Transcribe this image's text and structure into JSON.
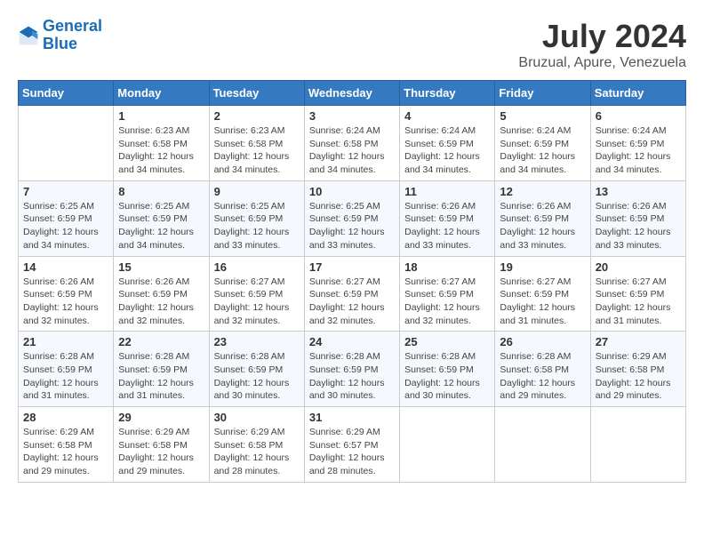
{
  "header": {
    "logo_line1": "General",
    "logo_line2": "Blue",
    "month_year": "July 2024",
    "location": "Bruzual, Apure, Venezuela"
  },
  "days_of_week": [
    "Sunday",
    "Monday",
    "Tuesday",
    "Wednesday",
    "Thursday",
    "Friday",
    "Saturday"
  ],
  "weeks": [
    [
      {
        "day": "",
        "info": ""
      },
      {
        "day": "1",
        "info": "Sunrise: 6:23 AM\nSunset: 6:58 PM\nDaylight: 12 hours\nand 34 minutes."
      },
      {
        "day": "2",
        "info": "Sunrise: 6:23 AM\nSunset: 6:58 PM\nDaylight: 12 hours\nand 34 minutes."
      },
      {
        "day": "3",
        "info": "Sunrise: 6:24 AM\nSunset: 6:58 PM\nDaylight: 12 hours\nand 34 minutes."
      },
      {
        "day": "4",
        "info": "Sunrise: 6:24 AM\nSunset: 6:59 PM\nDaylight: 12 hours\nand 34 minutes."
      },
      {
        "day": "5",
        "info": "Sunrise: 6:24 AM\nSunset: 6:59 PM\nDaylight: 12 hours\nand 34 minutes."
      },
      {
        "day": "6",
        "info": "Sunrise: 6:24 AM\nSunset: 6:59 PM\nDaylight: 12 hours\nand 34 minutes."
      }
    ],
    [
      {
        "day": "7",
        "info": "Sunrise: 6:25 AM\nSunset: 6:59 PM\nDaylight: 12 hours\nand 34 minutes."
      },
      {
        "day": "8",
        "info": "Sunrise: 6:25 AM\nSunset: 6:59 PM\nDaylight: 12 hours\nand 34 minutes."
      },
      {
        "day": "9",
        "info": "Sunrise: 6:25 AM\nSunset: 6:59 PM\nDaylight: 12 hours\nand 33 minutes."
      },
      {
        "day": "10",
        "info": "Sunrise: 6:25 AM\nSunset: 6:59 PM\nDaylight: 12 hours\nand 33 minutes."
      },
      {
        "day": "11",
        "info": "Sunrise: 6:26 AM\nSunset: 6:59 PM\nDaylight: 12 hours\nand 33 minutes."
      },
      {
        "day": "12",
        "info": "Sunrise: 6:26 AM\nSunset: 6:59 PM\nDaylight: 12 hours\nand 33 minutes."
      },
      {
        "day": "13",
        "info": "Sunrise: 6:26 AM\nSunset: 6:59 PM\nDaylight: 12 hours\nand 33 minutes."
      }
    ],
    [
      {
        "day": "14",
        "info": "Sunrise: 6:26 AM\nSunset: 6:59 PM\nDaylight: 12 hours\nand 32 minutes."
      },
      {
        "day": "15",
        "info": "Sunrise: 6:26 AM\nSunset: 6:59 PM\nDaylight: 12 hours\nand 32 minutes."
      },
      {
        "day": "16",
        "info": "Sunrise: 6:27 AM\nSunset: 6:59 PM\nDaylight: 12 hours\nand 32 minutes."
      },
      {
        "day": "17",
        "info": "Sunrise: 6:27 AM\nSunset: 6:59 PM\nDaylight: 12 hours\nand 32 minutes."
      },
      {
        "day": "18",
        "info": "Sunrise: 6:27 AM\nSunset: 6:59 PM\nDaylight: 12 hours\nand 32 minutes."
      },
      {
        "day": "19",
        "info": "Sunrise: 6:27 AM\nSunset: 6:59 PM\nDaylight: 12 hours\nand 31 minutes."
      },
      {
        "day": "20",
        "info": "Sunrise: 6:27 AM\nSunset: 6:59 PM\nDaylight: 12 hours\nand 31 minutes."
      }
    ],
    [
      {
        "day": "21",
        "info": "Sunrise: 6:28 AM\nSunset: 6:59 PM\nDaylight: 12 hours\nand 31 minutes."
      },
      {
        "day": "22",
        "info": "Sunrise: 6:28 AM\nSunset: 6:59 PM\nDaylight: 12 hours\nand 31 minutes."
      },
      {
        "day": "23",
        "info": "Sunrise: 6:28 AM\nSunset: 6:59 PM\nDaylight: 12 hours\nand 30 minutes."
      },
      {
        "day": "24",
        "info": "Sunrise: 6:28 AM\nSunset: 6:59 PM\nDaylight: 12 hours\nand 30 minutes."
      },
      {
        "day": "25",
        "info": "Sunrise: 6:28 AM\nSunset: 6:59 PM\nDaylight: 12 hours\nand 30 minutes."
      },
      {
        "day": "26",
        "info": "Sunrise: 6:28 AM\nSunset: 6:58 PM\nDaylight: 12 hours\nand 29 minutes."
      },
      {
        "day": "27",
        "info": "Sunrise: 6:29 AM\nSunset: 6:58 PM\nDaylight: 12 hours\nand 29 minutes."
      }
    ],
    [
      {
        "day": "28",
        "info": "Sunrise: 6:29 AM\nSunset: 6:58 PM\nDaylight: 12 hours\nand 29 minutes."
      },
      {
        "day": "29",
        "info": "Sunrise: 6:29 AM\nSunset: 6:58 PM\nDaylight: 12 hours\nand 29 minutes."
      },
      {
        "day": "30",
        "info": "Sunrise: 6:29 AM\nSunset: 6:58 PM\nDaylight: 12 hours\nand 28 minutes."
      },
      {
        "day": "31",
        "info": "Sunrise: 6:29 AM\nSunset: 6:57 PM\nDaylight: 12 hours\nand 28 minutes."
      },
      {
        "day": "",
        "info": ""
      },
      {
        "day": "",
        "info": ""
      },
      {
        "day": "",
        "info": ""
      }
    ]
  ]
}
